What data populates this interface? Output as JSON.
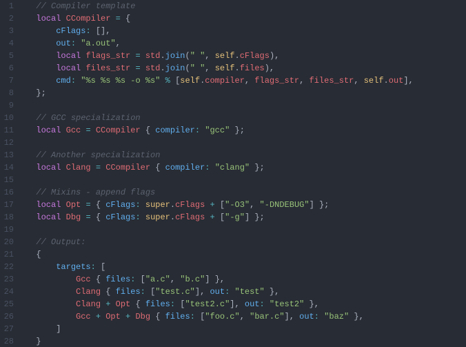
{
  "lines": [
    {
      "gutter": "1",
      "segs": [
        {
          "t": "  "
        },
        {
          "t": "// Compiler template",
          "c": "cmt"
        }
      ]
    },
    {
      "gutter": "2",
      "segs": [
        {
          "t": "  "
        },
        {
          "t": "local",
          "c": "kw"
        },
        {
          "t": " "
        },
        {
          "t": "CCompiler",
          "c": "id"
        },
        {
          "t": " "
        },
        {
          "t": "=",
          "c": "op"
        },
        {
          "t": " "
        },
        {
          "t": "{",
          "c": "pn"
        }
      ]
    },
    {
      "gutter": "3",
      "segs": [
        {
          "t": "      "
        },
        {
          "t": "cFlags",
          "c": "prop"
        },
        {
          "t": ":",
          "c": "op"
        },
        {
          "t": " "
        },
        {
          "t": "[]",
          "c": "pn"
        },
        {
          "t": ",",
          "c": "pn"
        }
      ]
    },
    {
      "gutter": "4",
      "segs": [
        {
          "t": "      "
        },
        {
          "t": "out",
          "c": "prop"
        },
        {
          "t": ":",
          "c": "op"
        },
        {
          "t": " "
        },
        {
          "t": "\"a.out\"",
          "c": "str"
        },
        {
          "t": ",",
          "c": "pn"
        }
      ]
    },
    {
      "gutter": "5",
      "segs": [
        {
          "t": "      "
        },
        {
          "t": "local",
          "c": "kw"
        },
        {
          "t": " "
        },
        {
          "t": "flags_str",
          "c": "id"
        },
        {
          "t": " "
        },
        {
          "t": "=",
          "c": "op"
        },
        {
          "t": " "
        },
        {
          "t": "std",
          "c": "id"
        },
        {
          "t": ".",
          "c": "pn"
        },
        {
          "t": "join",
          "c": "fn"
        },
        {
          "t": "(",
          "c": "pn"
        },
        {
          "t": "\" \"",
          "c": "str"
        },
        {
          "t": ", ",
          "c": "pn"
        },
        {
          "t": "self",
          "c": "self"
        },
        {
          "t": ".",
          "c": "pn"
        },
        {
          "t": "cFlags",
          "c": "id"
        },
        {
          "t": "),",
          "c": "pn"
        }
      ]
    },
    {
      "gutter": "6",
      "segs": [
        {
          "t": "      "
        },
        {
          "t": "local",
          "c": "kw"
        },
        {
          "t": " "
        },
        {
          "t": "files_str",
          "c": "id"
        },
        {
          "t": " "
        },
        {
          "t": "=",
          "c": "op"
        },
        {
          "t": " "
        },
        {
          "t": "std",
          "c": "id"
        },
        {
          "t": ".",
          "c": "pn"
        },
        {
          "t": "join",
          "c": "fn"
        },
        {
          "t": "(",
          "c": "pn"
        },
        {
          "t": "\" \"",
          "c": "str"
        },
        {
          "t": ", ",
          "c": "pn"
        },
        {
          "t": "self",
          "c": "self"
        },
        {
          "t": ".",
          "c": "pn"
        },
        {
          "t": "files",
          "c": "id"
        },
        {
          "t": "),",
          "c": "pn"
        }
      ]
    },
    {
      "gutter": "7",
      "segs": [
        {
          "t": "      "
        },
        {
          "t": "cmd",
          "c": "prop"
        },
        {
          "t": ":",
          "c": "op"
        },
        {
          "t": " "
        },
        {
          "t": "\"%s %s %s -o %s\"",
          "c": "str"
        },
        {
          "t": " "
        },
        {
          "t": "%",
          "c": "op"
        },
        {
          "t": " "
        },
        {
          "t": "[",
          "c": "pn"
        },
        {
          "t": "self",
          "c": "self"
        },
        {
          "t": ".",
          "c": "pn"
        },
        {
          "t": "compiler",
          "c": "id"
        },
        {
          "t": ", ",
          "c": "pn"
        },
        {
          "t": "flags_str",
          "c": "id"
        },
        {
          "t": ", ",
          "c": "pn"
        },
        {
          "t": "files_str",
          "c": "id"
        },
        {
          "t": ", ",
          "c": "pn"
        },
        {
          "t": "self",
          "c": "self"
        },
        {
          "t": ".",
          "c": "pn"
        },
        {
          "t": "out",
          "c": "id"
        },
        {
          "t": "],",
          "c": "pn"
        }
      ]
    },
    {
      "gutter": "8",
      "segs": [
        {
          "t": "  "
        },
        {
          "t": "};",
          "c": "pn"
        }
      ]
    },
    {
      "gutter": "9",
      "segs": []
    },
    {
      "gutter": "10",
      "segs": [
        {
          "t": "  "
        },
        {
          "t": "// GCC specialization",
          "c": "cmt"
        }
      ]
    },
    {
      "gutter": "11",
      "segs": [
        {
          "t": "  "
        },
        {
          "t": "local",
          "c": "kw"
        },
        {
          "t": " "
        },
        {
          "t": "Gcc",
          "c": "id"
        },
        {
          "t": " "
        },
        {
          "t": "=",
          "c": "op"
        },
        {
          "t": " "
        },
        {
          "t": "CCompiler",
          "c": "id"
        },
        {
          "t": " "
        },
        {
          "t": "{",
          "c": "pn"
        },
        {
          "t": " "
        },
        {
          "t": "compiler",
          "c": "prop"
        },
        {
          "t": ":",
          "c": "op"
        },
        {
          "t": " "
        },
        {
          "t": "\"gcc\"",
          "c": "str"
        },
        {
          "t": " "
        },
        {
          "t": "};",
          "c": "pn"
        }
      ]
    },
    {
      "gutter": "12",
      "segs": []
    },
    {
      "gutter": "13",
      "segs": [
        {
          "t": "  "
        },
        {
          "t": "// Another specialization",
          "c": "cmt"
        }
      ]
    },
    {
      "gutter": "14",
      "segs": [
        {
          "t": "  "
        },
        {
          "t": "local",
          "c": "kw"
        },
        {
          "t": " "
        },
        {
          "t": "Clang",
          "c": "id"
        },
        {
          "t": " "
        },
        {
          "t": "=",
          "c": "op"
        },
        {
          "t": " "
        },
        {
          "t": "CCompiler",
          "c": "id"
        },
        {
          "t": " "
        },
        {
          "t": "{",
          "c": "pn"
        },
        {
          "t": " "
        },
        {
          "t": "compiler",
          "c": "prop"
        },
        {
          "t": ":",
          "c": "op"
        },
        {
          "t": " "
        },
        {
          "t": "\"clang\"",
          "c": "str"
        },
        {
          "t": " "
        },
        {
          "t": "};",
          "c": "pn"
        }
      ]
    },
    {
      "gutter": "15",
      "segs": []
    },
    {
      "gutter": "16",
      "segs": [
        {
          "t": "  "
        },
        {
          "t": "// Mixins - append flags",
          "c": "cmt"
        }
      ]
    },
    {
      "gutter": "17",
      "segs": [
        {
          "t": "  "
        },
        {
          "t": "local",
          "c": "kw"
        },
        {
          "t": " "
        },
        {
          "t": "Opt",
          "c": "id"
        },
        {
          "t": " "
        },
        {
          "t": "=",
          "c": "op"
        },
        {
          "t": " "
        },
        {
          "t": "{",
          "c": "pn"
        },
        {
          "t": " "
        },
        {
          "t": "cFlags",
          "c": "prop"
        },
        {
          "t": ":",
          "c": "op"
        },
        {
          "t": " "
        },
        {
          "t": "super",
          "c": "self"
        },
        {
          "t": ".",
          "c": "pn"
        },
        {
          "t": "cFlags",
          "c": "id"
        },
        {
          "t": " "
        },
        {
          "t": "+",
          "c": "op"
        },
        {
          "t": " "
        },
        {
          "t": "[",
          "c": "pn"
        },
        {
          "t": "\"-O3\"",
          "c": "str"
        },
        {
          "t": ", ",
          "c": "pn"
        },
        {
          "t": "\"-DNDEBUG\"",
          "c": "str"
        },
        {
          "t": "] ",
          "c": "pn"
        },
        {
          "t": "};",
          "c": "pn"
        }
      ]
    },
    {
      "gutter": "18",
      "segs": [
        {
          "t": "  "
        },
        {
          "t": "local",
          "c": "kw"
        },
        {
          "t": " "
        },
        {
          "t": "Dbg",
          "c": "id"
        },
        {
          "t": " "
        },
        {
          "t": "=",
          "c": "op"
        },
        {
          "t": " "
        },
        {
          "t": "{",
          "c": "pn"
        },
        {
          "t": " "
        },
        {
          "t": "cFlags",
          "c": "prop"
        },
        {
          "t": ":",
          "c": "op"
        },
        {
          "t": " "
        },
        {
          "t": "super",
          "c": "self"
        },
        {
          "t": ".",
          "c": "pn"
        },
        {
          "t": "cFlags",
          "c": "id"
        },
        {
          "t": " "
        },
        {
          "t": "+",
          "c": "op"
        },
        {
          "t": " "
        },
        {
          "t": "[",
          "c": "pn"
        },
        {
          "t": "\"-g\"",
          "c": "str"
        },
        {
          "t": "] ",
          "c": "pn"
        },
        {
          "t": "};",
          "c": "pn"
        }
      ]
    },
    {
      "gutter": "19",
      "segs": []
    },
    {
      "gutter": "20",
      "segs": [
        {
          "t": "  "
        },
        {
          "t": "// Output:",
          "c": "cmt"
        }
      ]
    },
    {
      "gutter": "21",
      "segs": [
        {
          "t": "  "
        },
        {
          "t": "{",
          "c": "pn"
        }
      ]
    },
    {
      "gutter": "22",
      "segs": [
        {
          "t": "      "
        },
        {
          "t": "targets",
          "c": "prop"
        },
        {
          "t": ":",
          "c": "op"
        },
        {
          "t": " "
        },
        {
          "t": "[",
          "c": "pn"
        }
      ]
    },
    {
      "gutter": "23",
      "segs": [
        {
          "t": "          "
        },
        {
          "t": "Gcc",
          "c": "id"
        },
        {
          "t": " "
        },
        {
          "t": "{",
          "c": "pn"
        },
        {
          "t": " "
        },
        {
          "t": "files",
          "c": "prop"
        },
        {
          "t": ":",
          "c": "op"
        },
        {
          "t": " "
        },
        {
          "t": "[",
          "c": "pn"
        },
        {
          "t": "\"a.c\"",
          "c": "str"
        },
        {
          "t": ", ",
          "c": "pn"
        },
        {
          "t": "\"b.c\"",
          "c": "str"
        },
        {
          "t": "] ",
          "c": "pn"
        },
        {
          "t": "},",
          "c": "pn"
        }
      ]
    },
    {
      "gutter": "24",
      "segs": [
        {
          "t": "          "
        },
        {
          "t": "Clang",
          "c": "id"
        },
        {
          "t": " "
        },
        {
          "t": "{",
          "c": "pn"
        },
        {
          "t": " "
        },
        {
          "t": "files",
          "c": "prop"
        },
        {
          "t": ":",
          "c": "op"
        },
        {
          "t": " "
        },
        {
          "t": "[",
          "c": "pn"
        },
        {
          "t": "\"test.c\"",
          "c": "str"
        },
        {
          "t": "], ",
          "c": "pn"
        },
        {
          "t": "out",
          "c": "prop"
        },
        {
          "t": ":",
          "c": "op"
        },
        {
          "t": " "
        },
        {
          "t": "\"test\"",
          "c": "str"
        },
        {
          "t": " "
        },
        {
          "t": "},",
          "c": "pn"
        }
      ]
    },
    {
      "gutter": "25",
      "segs": [
        {
          "t": "          "
        },
        {
          "t": "Clang",
          "c": "id"
        },
        {
          "t": " "
        },
        {
          "t": "+",
          "c": "op"
        },
        {
          "t": " "
        },
        {
          "t": "Opt",
          "c": "id"
        },
        {
          "t": " "
        },
        {
          "t": "{",
          "c": "pn"
        },
        {
          "t": " "
        },
        {
          "t": "files",
          "c": "prop"
        },
        {
          "t": ":",
          "c": "op"
        },
        {
          "t": " "
        },
        {
          "t": "[",
          "c": "pn"
        },
        {
          "t": "\"test2.c\"",
          "c": "str"
        },
        {
          "t": "], ",
          "c": "pn"
        },
        {
          "t": "out",
          "c": "prop"
        },
        {
          "t": ":",
          "c": "op"
        },
        {
          "t": " "
        },
        {
          "t": "\"test2\"",
          "c": "str"
        },
        {
          "t": " "
        },
        {
          "t": "},",
          "c": "pn"
        }
      ]
    },
    {
      "gutter": "26",
      "segs": [
        {
          "t": "          "
        },
        {
          "t": "Gcc",
          "c": "id"
        },
        {
          "t": " "
        },
        {
          "t": "+",
          "c": "op"
        },
        {
          "t": " "
        },
        {
          "t": "Opt",
          "c": "id"
        },
        {
          "t": " "
        },
        {
          "t": "+",
          "c": "op"
        },
        {
          "t": " "
        },
        {
          "t": "Dbg",
          "c": "id"
        },
        {
          "t": " "
        },
        {
          "t": "{",
          "c": "pn"
        },
        {
          "t": " "
        },
        {
          "t": "files",
          "c": "prop"
        },
        {
          "t": ":",
          "c": "op"
        },
        {
          "t": " "
        },
        {
          "t": "[",
          "c": "pn"
        },
        {
          "t": "\"foo.c\"",
          "c": "str"
        },
        {
          "t": ", ",
          "c": "pn"
        },
        {
          "t": "\"bar.c\"",
          "c": "str"
        },
        {
          "t": "], ",
          "c": "pn"
        },
        {
          "t": "out",
          "c": "prop"
        },
        {
          "t": ":",
          "c": "op"
        },
        {
          "t": " "
        },
        {
          "t": "\"baz\"",
          "c": "str"
        },
        {
          "t": " "
        },
        {
          "t": "},",
          "c": "pn"
        }
      ]
    },
    {
      "gutter": "27",
      "segs": [
        {
          "t": "      "
        },
        {
          "t": "]",
          "c": "pn"
        }
      ]
    },
    {
      "gutter": "28",
      "segs": [
        {
          "t": "  "
        },
        {
          "t": "}",
          "c": "pn"
        }
      ]
    }
  ]
}
